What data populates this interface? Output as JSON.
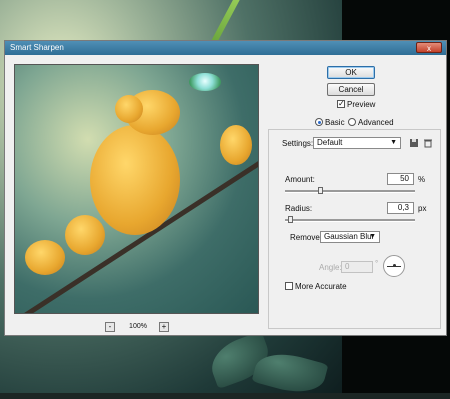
{
  "window": {
    "title": "Smart Sharpen",
    "close_glyph": "x"
  },
  "buttons": {
    "ok": "OK",
    "cancel": "Cancel"
  },
  "preview": {
    "label": "Preview",
    "checked": true,
    "checkmark": "✓"
  },
  "mode": {
    "basic": "Basic",
    "advanced": "Advanced",
    "selected": "Basic"
  },
  "settings": {
    "label": "Settings:",
    "value": "Default",
    "arrow": "▼"
  },
  "amount": {
    "label": "Amount:",
    "value": "50",
    "unit": "%"
  },
  "radius": {
    "label": "Radius:",
    "value": "0,3",
    "unit": "px"
  },
  "remove": {
    "label": "Remove:",
    "value": "Gaussian Blur",
    "arrow": "▼"
  },
  "angle": {
    "label": "Angle:",
    "value": "0",
    "unit": "°"
  },
  "more_accurate": {
    "label": "More Accurate",
    "checked": false
  },
  "zoom": {
    "value": "100%",
    "minus": "-",
    "plus": "+"
  },
  "icons": {
    "save_settings": "floppy-icon",
    "delete_settings": "trash-icon"
  },
  "colors": {
    "title_bar": "#2f6e96",
    "dialog_bg": "#f0f0f0",
    "close_button": "#c2412a"
  }
}
